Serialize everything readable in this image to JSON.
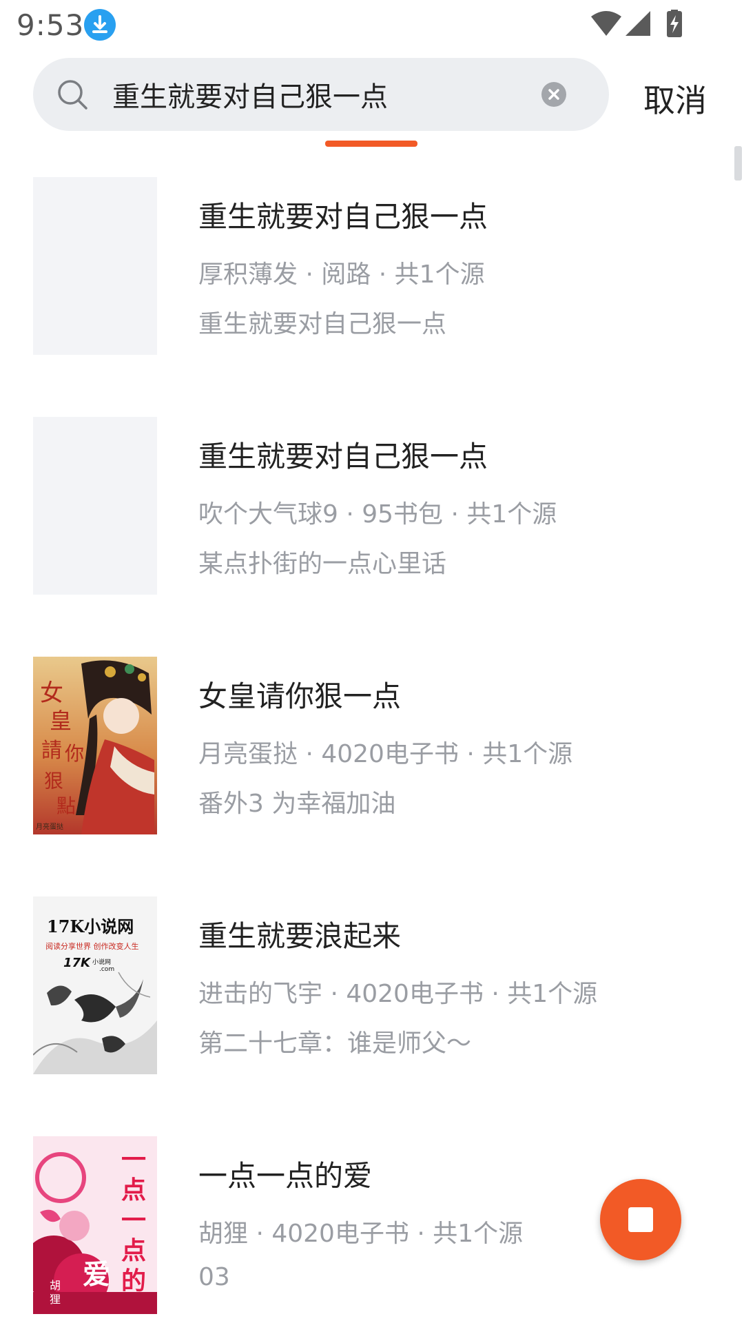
{
  "status_bar": {
    "time": "9:53",
    "icons": [
      "download-icon",
      "wifi-icon",
      "signal-icon",
      "battery-charging-icon"
    ]
  },
  "search": {
    "query": "重生就要对自己狠一点",
    "placeholder": "",
    "cancel_label": "取消"
  },
  "colors": {
    "accent": "#f25a26",
    "search_bg": "#eceef1",
    "meta_text": "#9a9da3",
    "title_text": "#222222"
  },
  "results": [
    {
      "title": "重生就要对自己狠一点",
      "meta": "厚积薄发 · 阅路 · 共1个源",
      "latest": "重生就要对自己狠一点",
      "cover": "blank"
    },
    {
      "title": "重生就要对自己狠一点",
      "meta": "吹个大气球9 · 95书包 · 共1个源",
      "latest": "某点扑街的一点心里话",
      "cover": "blank"
    },
    {
      "title": "女皇请你狠一点",
      "meta": "月亮蛋挞 · 4020电子书 · 共1个源",
      "latest": "番外3 为幸福加油",
      "cover": "illustration-empress",
      "cover_texts": [
        "女皇請你狠一點",
        "月亮蛋挞"
      ]
    },
    {
      "title": "重生就要浪起来",
      "meta": "进击的飞宇 · 4020电子书 · 共1个源",
      "latest": "第二十七章：谁是师父～",
      "cover": "illustration-17k",
      "cover_texts": [
        "17K小说网",
        "阅读分享世界 创作改变人生",
        "17K",
        "小说网",
        ".com"
      ]
    },
    {
      "title": "一点一点的爱",
      "meta": "胡狸 · 4020电子书 · 共1个源",
      "latest": "03",
      "cover": "illustration-pink",
      "cover_texts": [
        "一点一点的爱",
        "胡狸"
      ]
    }
  ],
  "fab": {
    "icon": "stop-icon"
  }
}
